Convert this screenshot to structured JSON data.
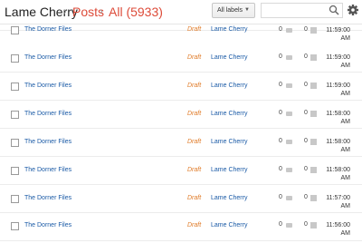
{
  "header": {
    "blog_title": "Lame Cherry",
    "separator": "›",
    "crumb_posts": "Posts",
    "crumb_all": "All (5933)",
    "labels_button": "All labels",
    "search_placeholder": ""
  },
  "posts": [
    {
      "title": "The Dorner Files",
      "status": "Draft",
      "author": "Lame Cherry",
      "comments": "0",
      "views": "0",
      "time": "11:59:00",
      "ampm": "AM"
    },
    {
      "title": "The Dorner Files",
      "status": "Draft",
      "author": "Lame Cherry",
      "comments": "0",
      "views": "0",
      "time": "11:59:00",
      "ampm": "AM"
    },
    {
      "title": "The Dorner Files",
      "status": "Draft",
      "author": "Lame Cherry",
      "comments": "0",
      "views": "0",
      "time": "11:59:00",
      "ampm": "AM"
    },
    {
      "title": "The Dorner Files",
      "status": "Draft",
      "author": "Lame Cherry",
      "comments": "0",
      "views": "0",
      "time": "11:58:00",
      "ampm": "AM"
    },
    {
      "title": "The Dorner Files",
      "status": "Draft",
      "author": "Lame Cherry",
      "comments": "0",
      "views": "0",
      "time": "11:58:00",
      "ampm": "AM"
    },
    {
      "title": "The Dorner Files",
      "status": "Draft",
      "author": "Lame Cherry",
      "comments": "0",
      "views": "0",
      "time": "11:58:00",
      "ampm": "AM"
    },
    {
      "title": "The Dorner Files",
      "status": "Draft",
      "author": "Lame Cherry",
      "comments": "0",
      "views": "0",
      "time": "11:57:00",
      "ampm": "AM"
    },
    {
      "title": "The Dorner Files",
      "status": "Draft",
      "author": "Lame Cherry",
      "comments": "0",
      "views": "0",
      "time": "11:56:00",
      "ampm": "AM"
    }
  ],
  "colors": {
    "accent": "#dd4b39",
    "link": "#1a5aa6",
    "draft": "#e07b28"
  }
}
